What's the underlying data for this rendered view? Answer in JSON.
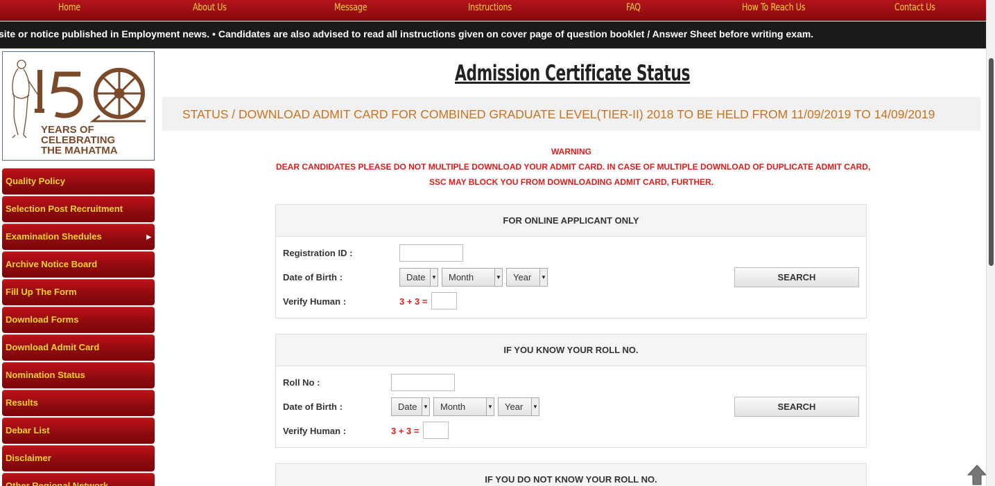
{
  "nav": {
    "items": [
      "Home",
      "About Us",
      "Message",
      "Instructions",
      "FAQ",
      "How To Reach Us",
      "Contact Us"
    ]
  },
  "ticker": {
    "text": "site or notice published in Employment news.  • Candidates are also advised to read all instructions given on cover page of question booklet / Answer Sheet before writing exam."
  },
  "logo": {
    "number": "150",
    "line1": "YEARS OF",
    "line2": "CELEBRATING",
    "line3": "THE MAHATMA"
  },
  "sidebar": {
    "items": [
      "Quality Policy",
      "Selection Post Recruitment",
      "Examination Shedules",
      "Archive Notice Board",
      "Fill Up The Form",
      "Download Forms",
      "Download Admit Card",
      "Nomination Status",
      "Results",
      "Debar List",
      "Disclaimer",
      "Other Regional Network"
    ]
  },
  "main": {
    "title": "Admission Certificate Status",
    "banner": "STATUS / DOWNLOAD ADMIT CARD FOR COMBINED GRADUATE LEVEL(TIER-II) 2018 TO BE HELD FROM 11/09/2019 TO 14/09/2019",
    "warning": {
      "heading": "WARNING",
      "line1": "DEAR CANDIDATES PLEASE DO NOT MULTIPLE DOWNLOAD YOUR ADMIT CARD. IN CASE OF MULTIPLE DOWNLOAD OF DUPLICATE ADMIT CARD,",
      "line2": "SSC MAY BLOCK YOU FROM DOWNLOADING ADMIT CARD, FURTHER."
    },
    "panel1": {
      "heading": "FOR ONLINE APPLICANT ONLY",
      "id_label": "Registration ID :",
      "dob_label": "Date of Birth :",
      "verify_label": "Verify Human :",
      "date": "Date",
      "month": "Month",
      "year": "Year",
      "captcha": "3 + 3 =",
      "search": "SEARCH"
    },
    "panel2": {
      "heading": "IF YOU KNOW YOUR ROLL NO.",
      "id_label": "Roll No :",
      "dob_label": "Date of Birth :",
      "verify_label": "Verify Human :",
      "date": "Date",
      "month": "Month",
      "year": "Year",
      "captcha": "3 + 3 =",
      "search": "SEARCH"
    },
    "panel3": {
      "heading": "IF YOU DO NOT KNOW YOUR ROLL NO."
    }
  },
  "colors": {
    "nav_red": "#a8121a",
    "nav_text": "#f5d232",
    "banner_text": "#c9731e",
    "warning_red": "#e01b1b",
    "logo_brown": "#7a4a2a"
  }
}
